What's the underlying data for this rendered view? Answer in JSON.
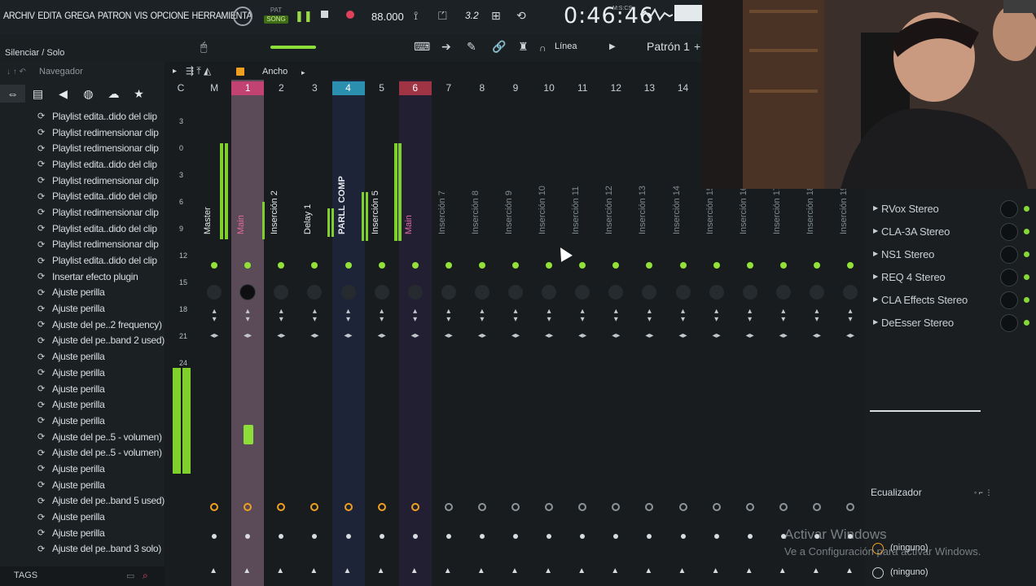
{
  "menu": [
    "ARCHIV",
    "EDITA",
    "GREGA",
    "PATRON",
    "VIS",
    "OPCIONE",
    "HERRAMIENTA"
  ],
  "transport": {
    "pat_label": "PAT",
    "song_label": "SONG",
    "tempo": "88.000",
    "tempo_small": "3.2",
    "time": "0:46:46",
    "time_unit": "M:S:CS"
  },
  "toolbar2": {
    "silence_label": "Silenciar / Solo",
    "linea_label": "Línea",
    "pattern_label": "Patrón 1",
    "add_label": "+"
  },
  "browser": {
    "nav_label": "Navegador",
    "tabs": [
      "all-icon",
      "file-icon",
      "plugin-icon",
      "globe-icon",
      "cloud-icon",
      "star-icon"
    ],
    "history": [
      "Playlist edita..dido del clip",
      "Playlist redimensionar clip",
      "Playlist redimensionar clip",
      "Playlist edita..dido del clip",
      "Playlist redimensionar clip",
      "Playlist edita..dido del clip",
      "Playlist redimensionar clip",
      "Playlist edita..dido del clip",
      "Playlist redimensionar clip",
      "Playlist edita..dido del clip",
      "Insertar efecto plugin",
      "Ajuste perilla",
      "Ajuste perilla",
      "Ajuste del pe..2 frequency)",
      "Ajuste del pe..band 2 used)",
      "Ajuste perilla",
      "Ajuste perilla",
      "Ajuste perilla",
      "Ajuste perilla",
      "Ajuste perilla",
      "Ajuste del pe..5 - volumen)",
      "Ajuste del pe..5 - volumen)",
      "Ajuste perilla",
      "Ajuste perilla",
      "Ajuste del pe..band 5 used)",
      "Ajuste perilla",
      "Ajuste perilla",
      "Ajuste del pe..band 3 solo)"
    ],
    "tags_label": "TAGS"
  },
  "mixer": {
    "width_label": "Ancho",
    "scale": [
      "3",
      "0",
      "3",
      "6",
      "9",
      "12",
      "15",
      "18",
      "21",
      "24"
    ],
    "tracks": [
      {
        "num": "C",
        "name": ""
      },
      {
        "num": "M",
        "name": "Master"
      },
      {
        "num": "1",
        "name": "Main"
      },
      {
        "num": "2",
        "name": "Inserción 2"
      },
      {
        "num": "3",
        "name": "Delay 1"
      },
      {
        "num": "4",
        "name": "PARLL COMP"
      },
      {
        "num": "5",
        "name": "Inserción 5"
      },
      {
        "num": "6",
        "name": "Main"
      },
      {
        "num": "7",
        "name": "Inserción 7"
      },
      {
        "num": "8",
        "name": "Inserción 8"
      },
      {
        "num": "9",
        "name": "Inserción 9"
      },
      {
        "num": "10",
        "name": "Inserción 10"
      },
      {
        "num": "11",
        "name": "Inserción 11"
      },
      {
        "num": "12",
        "name": "Inserción 12"
      },
      {
        "num": "13",
        "name": "Inserción 13"
      },
      {
        "num": "14",
        "name": "Inserción 14"
      },
      {
        "num": "",
        "name": "Inserción 15"
      },
      {
        "num": "",
        "name": "Inserción 16"
      },
      {
        "num": "",
        "name": "Inserción 17"
      },
      {
        "num": "",
        "name": "Inserción 18"
      },
      {
        "num": "",
        "name": "Inserción 19"
      }
    ]
  },
  "plugins": {
    "items": [
      "RVox Stereo",
      "CLA-3A Stereo",
      "NS1 Stereo",
      "REQ 4 Stereo",
      "CLA Effects Stereo",
      "DeEsser Stereo"
    ],
    "eq_label": "Ecualizador",
    "slot1": "(ninguno)",
    "slot2": "(ninguno)"
  },
  "watermark": {
    "title": "Activar Windows",
    "subtitle": "Ve a Configuración para activar Windows."
  },
  "colors": {
    "accent_green": "#8ede3a",
    "selected_strip": "#5b4a58",
    "pink_highlight": "#c24272",
    "blue_highlight": "#2b8fb0"
  }
}
